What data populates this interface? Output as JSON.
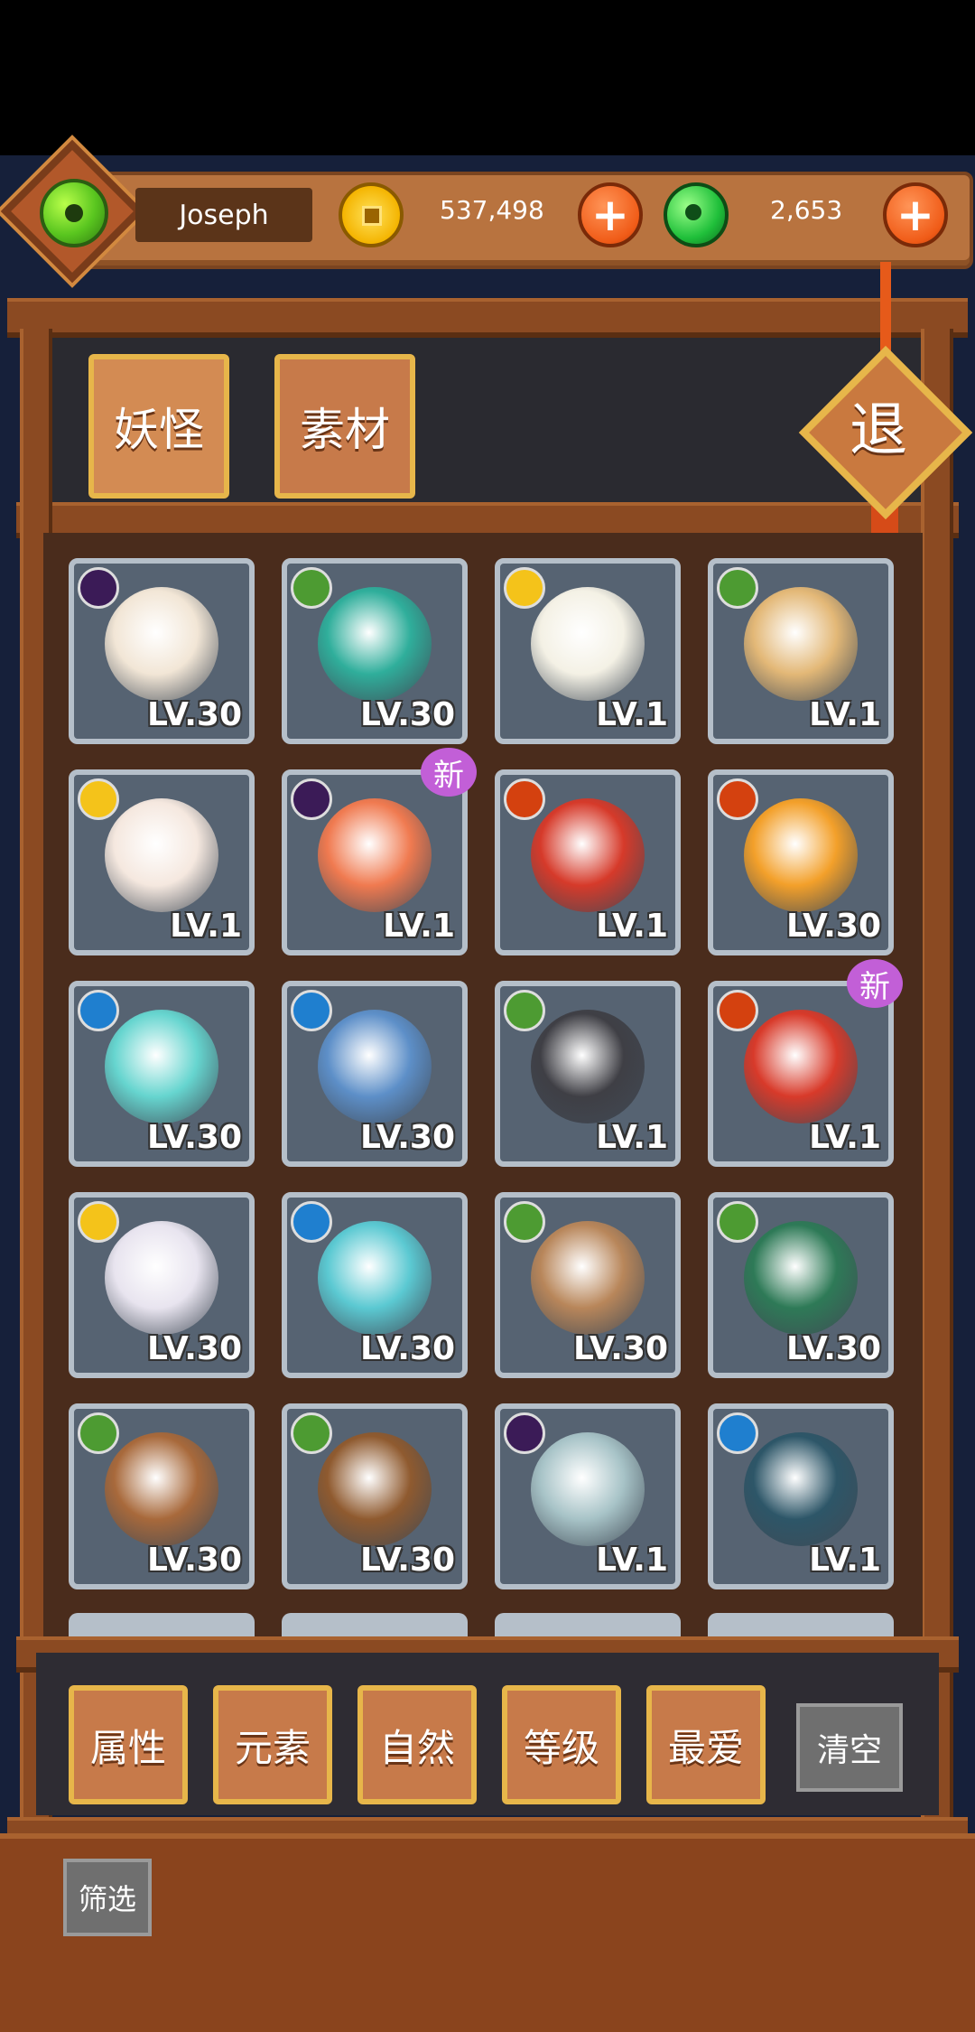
{
  "header": {
    "player_name": "Joseph",
    "coins": "537,498",
    "gems": "2,653"
  },
  "tabs": [
    {
      "label": "妖怪",
      "active": true
    },
    {
      "label": "素材",
      "active": false
    }
  ],
  "exit_label": "退",
  "new_badge_label": "新",
  "element_colors": {
    "dark": "#3b1b57",
    "nature": "#4d9b32",
    "light": "#f4c31a",
    "fire": "#d4410f",
    "water": "#1f7fcf"
  },
  "monsters": [
    {
      "level": "LV.30",
      "element": "dark",
      "new": false,
      "color": "#f2e6d6"
    },
    {
      "level": "LV.30",
      "element": "nature",
      "new": false,
      "color": "#2fae9b"
    },
    {
      "level": "LV.1",
      "element": "light",
      "new": false,
      "color": "#f4f1e5"
    },
    {
      "level": "LV.1",
      "element": "nature",
      "new": false,
      "color": "#e3b877"
    },
    {
      "level": "LV.1",
      "element": "light",
      "new": false,
      "color": "#f5e8df"
    },
    {
      "level": "LV.1",
      "element": "dark",
      "new": true,
      "color": "#f07a50"
    },
    {
      "level": "LV.1",
      "element": "fire",
      "new": false,
      "color": "#d63a2a"
    },
    {
      "level": "LV.30",
      "element": "fire",
      "new": false,
      "color": "#f3a02a"
    },
    {
      "level": "LV.30",
      "element": "water",
      "new": false,
      "color": "#66d5cf"
    },
    {
      "level": "LV.30",
      "element": "water",
      "new": false,
      "color": "#5d8fc8"
    },
    {
      "level": "LV.1",
      "element": "nature",
      "new": false,
      "color": "#3f3f45"
    },
    {
      "level": "LV.1",
      "element": "fire",
      "new": true,
      "color": "#d83a2a"
    },
    {
      "level": "LV.30",
      "element": "light",
      "new": false,
      "color": "#e8e4ef"
    },
    {
      "level": "LV.30",
      "element": "water",
      "new": false,
      "color": "#5bc9d2"
    },
    {
      "level": "LV.30",
      "element": "nature",
      "new": false,
      "color": "#b8865a"
    },
    {
      "level": "LV.30",
      "element": "nature",
      "new": false,
      "color": "#2e7a57"
    },
    {
      "level": "LV.30",
      "element": "nature",
      "new": false,
      "color": "#a8693b"
    },
    {
      "level": "LV.30",
      "element": "nature",
      "new": false,
      "color": "#8f5a2f"
    },
    {
      "level": "LV.1",
      "element": "dark",
      "new": false,
      "color": "#a7c3c7"
    },
    {
      "level": "LV.1",
      "element": "water",
      "new": false,
      "color": "#2d5668"
    }
  ],
  "filters": [
    {
      "label": "属性"
    },
    {
      "label": "元素"
    },
    {
      "label": "自然"
    },
    {
      "label": "等级"
    },
    {
      "label": "最爱"
    }
  ],
  "clear_label": "清空",
  "screen_label": "筛选"
}
